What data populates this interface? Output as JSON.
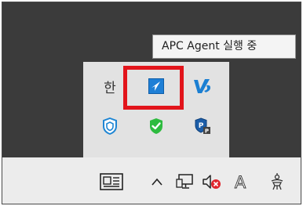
{
  "tooltip": {
    "text": "APC Agent 실행 중"
  },
  "tray_overflow": {
    "items": [
      {
        "name": "ime-korean",
        "label": "한"
      },
      {
        "name": "apc-agent-icon"
      },
      {
        "name": "vs-icon"
      },
      {
        "name": "defender-shield-icon"
      },
      {
        "name": "security-check-icon"
      },
      {
        "name": "protection-shield-icon"
      }
    ]
  },
  "taskbar": {
    "icons": [
      "news-icon",
      "chevron-up-icon",
      "network-icon",
      "volume-muted-icon",
      "ime-mode-icon",
      "settings-icon"
    ],
    "ime_mode": "A"
  },
  "colors": {
    "highlight": "#e2141b",
    "apc_blue": "#1e7fd6",
    "check_green": "#2dbb3f",
    "vs_blue": "#1b7fd2"
  }
}
